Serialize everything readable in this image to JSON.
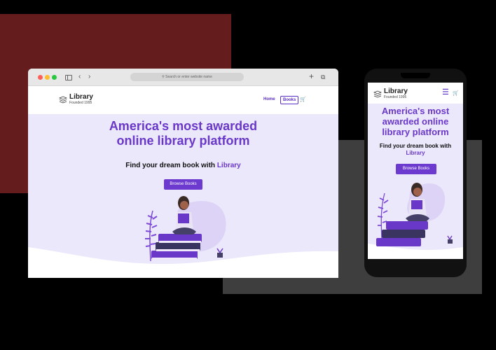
{
  "browser": {
    "address_placeholder": "Search or enter website name"
  },
  "site": {
    "logo_name": "Library",
    "logo_tagline": "Founded 1995",
    "nav_home": "Home",
    "nav_books": "Books",
    "headline_line1": "America's most awarded",
    "headline_line2": "online library platform",
    "subhead_prefix": "Find your dream book with",
    "subhead_accent": "Library",
    "cta_label": "Browse Books"
  },
  "mobile": {
    "logo_name": "Library",
    "logo_tagline": "Founded 1995",
    "headline_line1": "America's most",
    "headline_line2": "awarded online",
    "headline_line3": "library platform",
    "subhead_prefix": "Find your dream book with",
    "subhead_accent": "Library",
    "cta_label": "Browse Books"
  },
  "icons": {
    "cart": "cart-icon",
    "menu": "hamburger-menu-icon",
    "back": "chevron-left-icon",
    "forward": "chevron-right-icon",
    "new_tab": "plus-icon",
    "tabs": "tabs-icon"
  },
  "colors": {
    "accent": "#6a38c9",
    "hero_bg": "#ece8fb",
    "backdrop_red": "#651c1c",
    "backdrop_gray": "#3e3e3e"
  }
}
